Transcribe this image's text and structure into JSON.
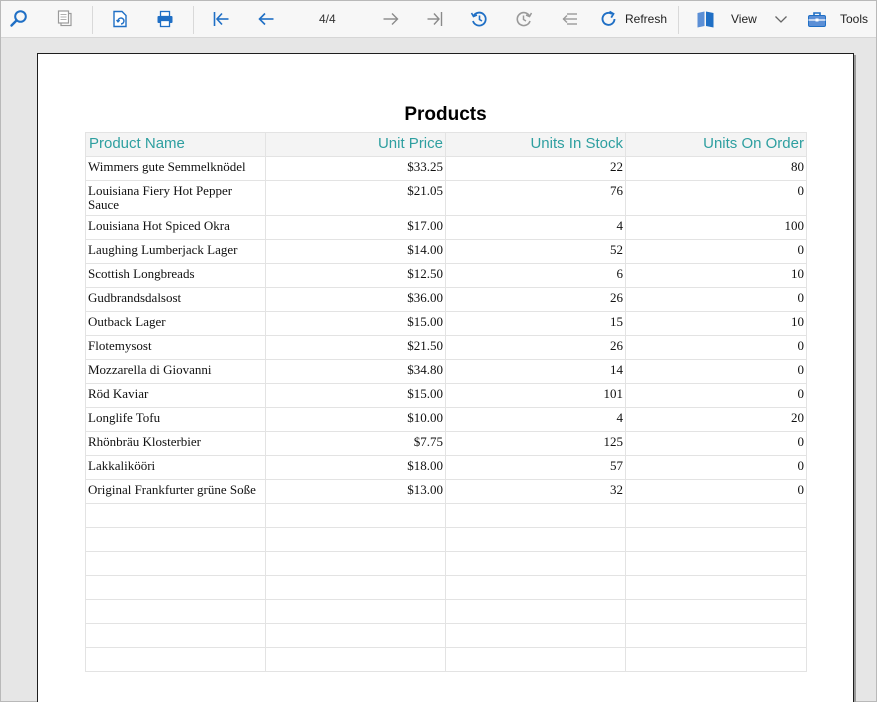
{
  "toolbar": {
    "page_indicator": "4/4",
    "refresh_label": "Refresh",
    "view_label": "View",
    "tools_label": "Tools",
    "icons": [
      "search-icon",
      "pages-icon",
      "export-icon",
      "print-icon",
      "first-page-icon",
      "previous-page-icon",
      "next-page-icon",
      "last-page-icon",
      "history-back-icon",
      "history-forward-icon",
      "parent-report-icon",
      "refresh-icon",
      "view-icon",
      "chevron-down-icon",
      "tools-icon"
    ],
    "accent_color": "#1f6fc5"
  },
  "report": {
    "title": "Products",
    "header_color": "#2e9fa0",
    "columns": [
      "Product Name",
      "Unit Price",
      "Units In Stock",
      "Units On Order"
    ],
    "rows": [
      [
        "Wimmers gute Semmelknödel",
        "$33.25",
        "22",
        "80"
      ],
      [
        "Louisiana Fiery Hot Pepper Sauce",
        "$21.05",
        "76",
        "0"
      ],
      [
        "Louisiana Hot Spiced Okra",
        "$17.00",
        "4",
        "100"
      ],
      [
        "Laughing Lumberjack Lager",
        "$14.00",
        "52",
        "0"
      ],
      [
        "Scottish Longbreads",
        "$12.50",
        "6",
        "10"
      ],
      [
        "Gudbrandsdalsost",
        "$36.00",
        "26",
        "0"
      ],
      [
        "Outback Lager",
        "$15.00",
        "15",
        "10"
      ],
      [
        "Flotemysost",
        "$21.50",
        "26",
        "0"
      ],
      [
        "Mozzarella di Giovanni",
        "$34.80",
        "14",
        "0"
      ],
      [
        "Röd Kaviar",
        "$15.00",
        "101",
        "0"
      ],
      [
        "Longlife Tofu",
        "$10.00",
        "4",
        "20"
      ],
      [
        "Rhönbräu Klosterbier",
        "$7.75",
        "125",
        "0"
      ],
      [
        "Lakkalikööri",
        "$18.00",
        "57",
        "0"
      ],
      [
        "Original Frankfurter grüne Soße",
        "$13.00",
        "32",
        "0"
      ]
    ]
  }
}
